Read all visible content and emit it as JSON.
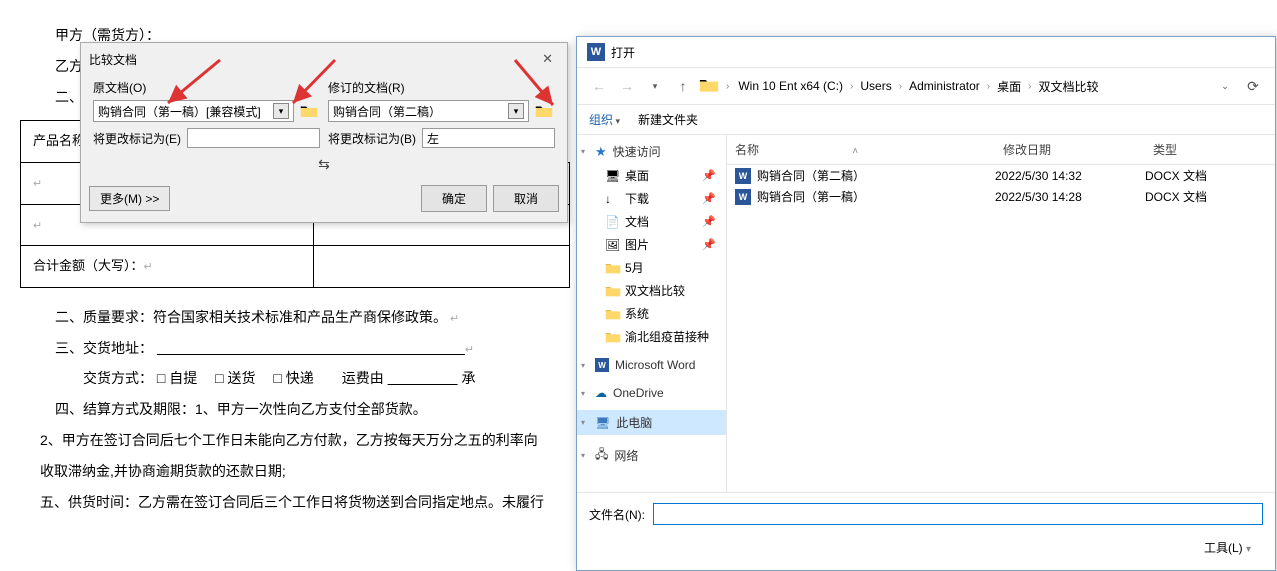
{
  "doc": {
    "line1": "甲方（需货方）：",
    "line2": "乙方",
    "row_header": "产品名称",
    "sum_label": "合计金额（大写）：",
    "para2": "二、质量要求：符合国家相关技术标准和产品生产商保修政策。",
    "para3": "三、交货地址：",
    "para3b_prefix": "交货方式：",
    "cb1": "自提",
    "cb2": "送货",
    "cb3": "快递",
    "fee_prefix": "运费由",
    "fee_suffix": "承",
    "para4": "四、结算方式及期限：1、甲方一次性向乙方支付全部货款。",
    "para5": "2、甲方在签订合同后七个工作日未能向乙方付款，乙方按每天万分之五的利率向",
    "para6": "收取滞纳金,并协商逾期货款的还款日期;",
    "para7": "五、供货时间：乙方需在签订合同后三个工作日将货物送到合同指定地点。未履行"
  },
  "compare": {
    "title": "比较文档",
    "orig_label": "原文档(O)",
    "orig_value": "购销合同（第一稿）[兼容模式]",
    "orig_mark_label": "将更改标记为(E)",
    "orig_mark_value": "",
    "rev_label": "修订的文档(R)",
    "rev_value": "购销合同（第二稿）",
    "rev_mark_label": "将更改标记为(B)",
    "rev_mark_value": "左",
    "swap": "⇆",
    "more": "更多(M) >>",
    "ok": "确定",
    "cancel": "取消"
  },
  "open": {
    "title": "打开",
    "breadcrumb": [
      "Win 10 Ent x64 (C:)",
      "Users",
      "Administrator",
      "桌面",
      "双文档比较"
    ],
    "organize": "组织",
    "new_folder": "新建文件夹",
    "sidebar": {
      "quick": "快速访问",
      "items": [
        {
          "label": "桌面",
          "icon": "desktop",
          "pin": true
        },
        {
          "label": "下载",
          "icon": "download",
          "pin": true
        },
        {
          "label": "文档",
          "icon": "doc",
          "pin": true
        },
        {
          "label": "图片",
          "icon": "pic",
          "pin": true
        },
        {
          "label": "5月",
          "icon": "folder",
          "pin": false
        },
        {
          "label": "双文档比较",
          "icon": "folder",
          "pin": false
        },
        {
          "label": "系统",
          "icon": "folder",
          "pin": false
        },
        {
          "label": "渝北组疫苗接种",
          "icon": "folder",
          "pin": false
        }
      ],
      "word": "Microsoft Word",
      "onedrive": "OneDrive",
      "thispc": "此电脑",
      "network": "网络"
    },
    "columns": {
      "name": "名称",
      "date": "修改日期",
      "type": "类型"
    },
    "files": [
      {
        "name": "购销合同（第二稿）",
        "date": "2022/5/30 14:32",
        "type": "DOCX 文档"
      },
      {
        "name": "购销合同（第一稿）",
        "date": "2022/5/30 14:28",
        "type": "DOCX 文档"
      }
    ],
    "filename_label": "文件名(N):",
    "filename_value": "",
    "tools": "工具(L)"
  }
}
